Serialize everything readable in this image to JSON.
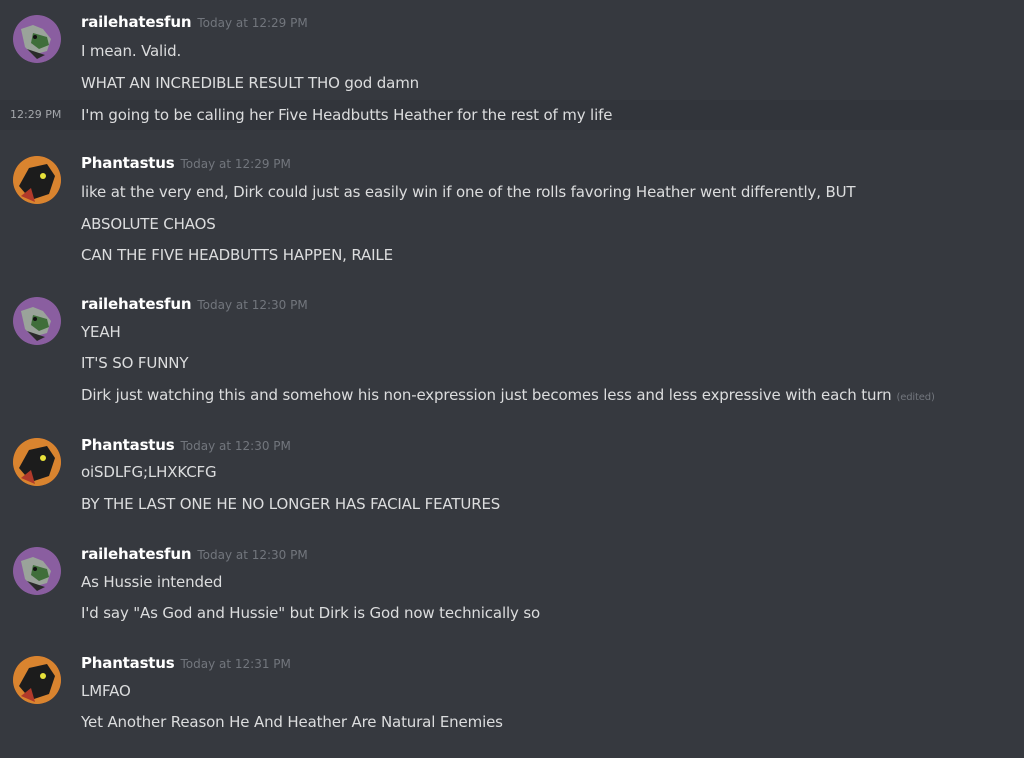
{
  "messages": [
    {
      "author": "railehatesfun",
      "timestamp": "Today at 12:29 PM",
      "avatar_icon": "raile-avatar-icon",
      "lines": [
        {
          "text": "I mean. Valid."
        },
        {
          "text": "WHAT AN INCREDIBLE RESULT THO god damn"
        },
        {
          "text": "I'm going to be calling her Five Headbutts Heather for the rest of my life",
          "hover_time": "12:29 PM"
        }
      ]
    },
    {
      "author": "Phantastus",
      "timestamp": "Today at 12:29 PM",
      "avatar_icon": "phantastus-avatar-icon",
      "lines": [
        {
          "text": "like at the very end, Dirk could just as easily win if one of the rolls favoring Heather went differently, BUT"
        },
        {
          "text": "ABSOLUTE CHAOS"
        },
        {
          "text": "CAN THE FIVE HEADBUTTS HAPPEN, RAILE"
        }
      ]
    },
    {
      "author": "railehatesfun",
      "timestamp": "Today at 12:30 PM",
      "avatar_icon": "raile-avatar-icon",
      "lines": [
        {
          "text": "YEAH"
        },
        {
          "text": "IT'S SO FUNNY"
        },
        {
          "text": "Dirk just watching this and somehow his non-expression just becomes less and less expressive with each turn",
          "edited": "(edited)"
        }
      ]
    },
    {
      "author": "Phantastus",
      "timestamp": "Today at 12:30 PM",
      "avatar_icon": "phantastus-avatar-icon",
      "lines": [
        {
          "text": "oiSDLFG;LHXKCFG"
        },
        {
          "text": "BY THE LAST ONE HE NO LONGER HAS FACIAL FEATURES"
        }
      ]
    },
    {
      "author": "railehatesfun",
      "timestamp": "Today at 12:30 PM",
      "avatar_icon": "raile-avatar-icon",
      "lines": [
        {
          "text": "As Hussie intended"
        },
        {
          "text": "I'd say \"As God and Hussie\" but Dirk is God now technically so"
        }
      ]
    },
    {
      "author": "Phantastus",
      "timestamp": "Today at 12:31 PM",
      "avatar_icon": "phantastus-avatar-icon",
      "lines": [
        {
          "text": "LMFAO"
        },
        {
          "text": "Yet Another Reason He And Heather Are Natural Enemies"
        }
      ]
    }
  ],
  "colors": {
    "background": "#36393f",
    "hover_background": "#32353b",
    "username": "#ffffff",
    "message_text": "#dcddde",
    "timestamp": "#72767d"
  }
}
